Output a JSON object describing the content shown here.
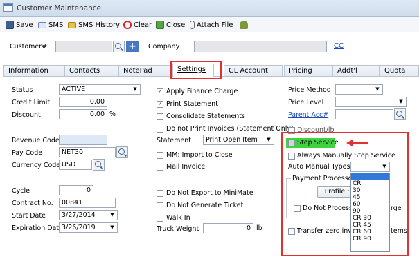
{
  "window": {
    "title": "Customer Maintenance"
  },
  "toolbar": {
    "save": "Save",
    "sms": "SMS",
    "sms_history": "SMS History",
    "clear": "Clear",
    "close": "Close",
    "attach_file": "Attach File"
  },
  "header": {
    "customer_label": "Customer#",
    "customer_value": "",
    "company_label": "Company",
    "company_value": "",
    "cc_link": "CC"
  },
  "tabs": [
    "Information",
    "Contacts",
    "NotePad",
    "Settings",
    "GL Account",
    "Pricing",
    "Addt'l",
    "Quota"
  ],
  "left": {
    "status_label": "Status",
    "status_value": "ACTIVE",
    "credit_limit_label": "Credit Limit",
    "credit_limit_value": "0.00",
    "discount_label": "Discount",
    "discount_value": "0.00",
    "discount_unit": "%",
    "revenue_code_label": "Revenue Code",
    "revenue_code_value": "",
    "pay_code_label": "Pay Code",
    "pay_code_value": "NET30",
    "currency_code_label": "Currency Code",
    "currency_code_value": "USD",
    "cycle_label": "Cycle",
    "cycle_value": "0",
    "contract_label": "Contract No.",
    "contract_value": "00841",
    "start_date_label": "Start Date",
    "start_date_value": "3/27/2014",
    "expiration_date_label": "Expiration Date",
    "expiration_date_value": "3/26/2019"
  },
  "middle": {
    "apply_finance_charge": "Apply Finance Charge",
    "print_statement": "Print Statement",
    "consolidate_statements": "Consolidate Statements",
    "do_not_print_invoices": "Do not Print Invoices (Statement Only)",
    "statement_label": "Statement",
    "statement_value": "Print Open Item",
    "mm_import": "MM:  Import to Close",
    "mail_invoice": "Mail Invoice",
    "do_not_export": "Do Not Export to MiniMate",
    "do_not_generate_ticket": "Do Not Generate Ticket",
    "walk_in": "Walk In",
    "truck_weight_label": "Truck Weight",
    "truck_weight_value": "0",
    "truck_weight_unit": "lb"
  },
  "right": {
    "price_method_label": "Price Method",
    "price_method_value": "",
    "price_level_label": "Price Level",
    "price_level_value": "",
    "parent_acc_label": "Parent Acc#",
    "parent_acc_value": "",
    "discount_lb": "Discount/lb",
    "stop_service": "Stop Service",
    "always_manually_stop": "Always Manually Stop Service",
    "auto_manual_types_label": "Auto Manual Types",
    "auto_manual_types_value": "",
    "auto_manual_options": [
      "",
      "CR",
      "30",
      "45",
      "60",
      "90",
      "CR 30",
      "CR 45",
      "CR 60",
      "CR 90"
    ],
    "payment_processor_label": "Payment Processo",
    "profile_button": "Profile S",
    "do_not_process": "Do Not Process",
    "do_not_process_tail": "rge",
    "transfer_zero": "Transfer zero invo",
    "transfer_zero_tail": "tems"
  },
  "colors": {
    "highlight": "#3ed43e",
    "annotation": "#e03030",
    "link": "#1a4bbf",
    "selected": "#3278d6"
  }
}
